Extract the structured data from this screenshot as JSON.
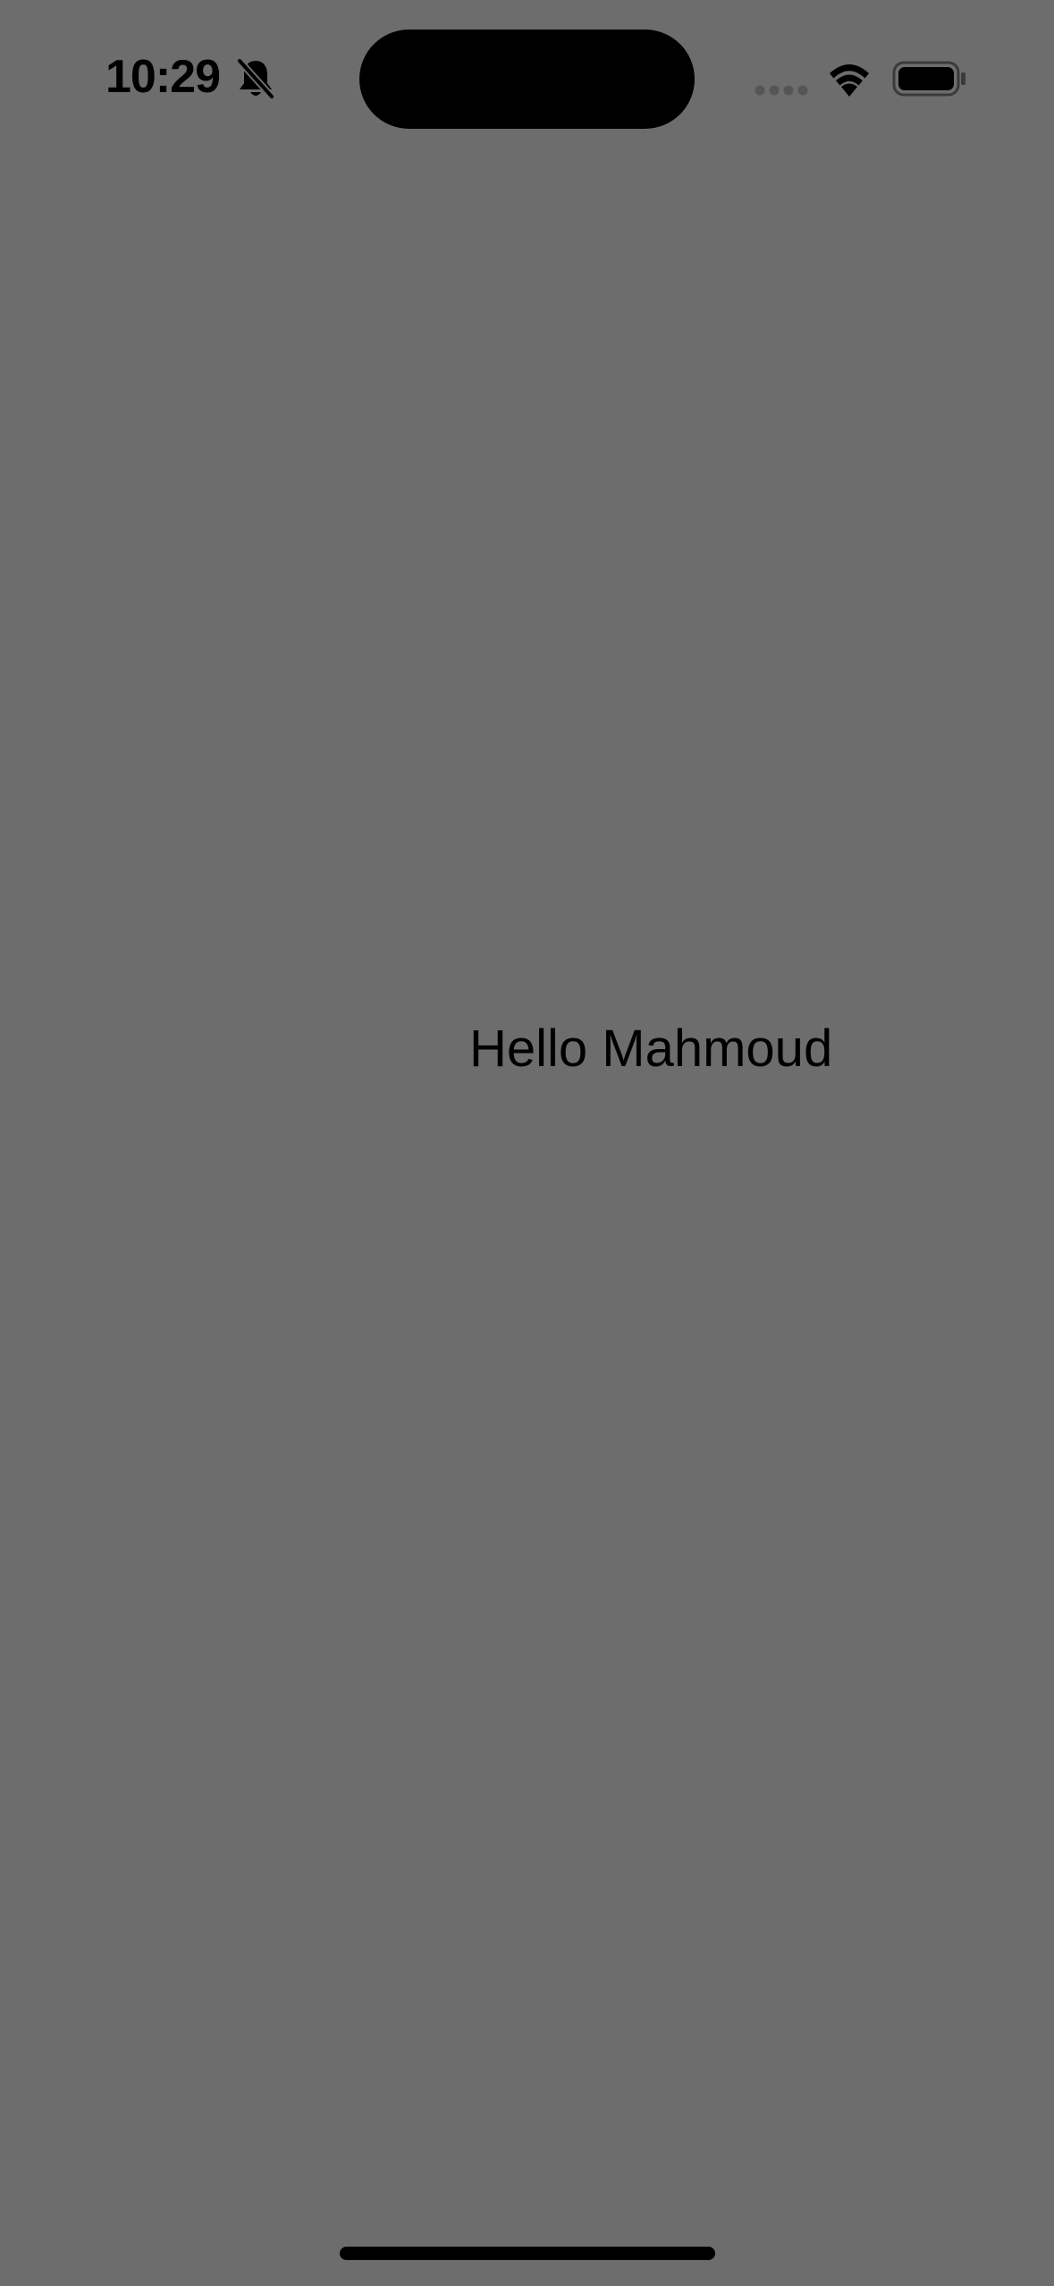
{
  "status_bar": {
    "time": "10:29",
    "mute_icon": "bell-slash-icon",
    "signal_icon": "cellular-signal-icon",
    "wifi_icon": "wifi-icon",
    "battery_icon": "battery-full-icon"
  },
  "main": {
    "greeting": "Hello Mahmoud"
  },
  "colors": {
    "background": "#6d6d6d",
    "text": "#000000"
  }
}
